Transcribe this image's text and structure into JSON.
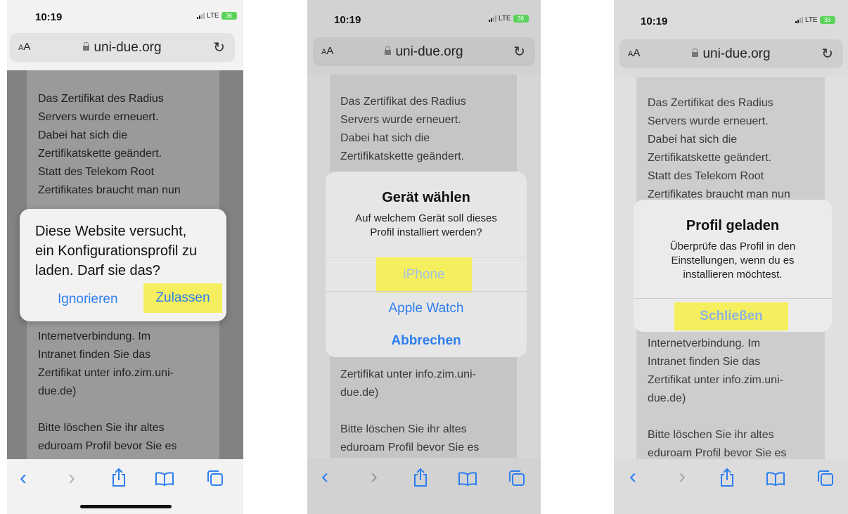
{
  "common": {
    "time": "10:19",
    "network": "LTE",
    "battery": "36",
    "text_size_button": "AA",
    "domain": "uni-due.org",
    "reload_icon": "reload-icon",
    "toolbar_icons": [
      "back-chevron-icon",
      "forward-chevron-icon",
      "share-icon",
      "bookmarks-icon",
      "tabs-icon"
    ]
  },
  "panels": [
    {
      "page_text_top": [
        "Das Zertifikat des Radius",
        "Servers wurde erneuert.",
        "Dabei hat sich die",
        "Zertifikatskette geändert.",
        "Statt des Telekom Root",
        "Zertifikates braucht man nun"
      ],
      "page_text_bottom": [
        "Internetverbindung. Im",
        "Intranet finden Sie das",
        "Zertifikat unter info.zim.uni-",
        "due.de)"
      ],
      "page_text_end": [
        "Bitte löschen Sie ihr altes",
        "eduroam Profil bevor Sie es"
      ],
      "dialog": {
        "message": [
          "Diese Website versucht,",
          "ein Konfigurationsprofil zu",
          "laden. Darf sie das?"
        ],
        "buttons": [
          "Ignorieren",
          "Zulassen"
        ],
        "highlighted_button": "Zulassen"
      }
    },
    {
      "page_text_top": [
        "Das Zertifikat des Radius",
        "Servers wurde erneuert.",
        "Dabei hat sich die",
        "Zertifikatskette geändert."
      ],
      "page_text_bottom": [
        "Zertifikat unter info.zim.uni-",
        "due.de)"
      ],
      "page_text_end": [
        "Bitte löschen Sie ihr altes",
        "eduroam Profil bevor Sie es"
      ],
      "dialog": {
        "title": "Gerät wählen",
        "message": [
          "Auf welchem Gerät soll dieses",
          "Profil installiert werden?"
        ],
        "buttons": [
          "iPhone",
          "Apple Watch",
          "Abbrechen"
        ],
        "highlighted_button": "iPhone"
      }
    },
    {
      "page_text_top": [
        "Das Zertifikat des Radius",
        "Servers wurde erneuert.",
        "Dabei hat sich die",
        "Zertifikatskette geändert.",
        "Statt des Telekom Root",
        "Zertifikates braucht man nun"
      ],
      "page_text_bottom": [
        "Internetverbindung. Im",
        "Intranet finden Sie das",
        "Zertifikat unter info.zim.uni-",
        "due.de)"
      ],
      "page_text_end": [
        "Bitte löschen Sie ihr altes",
        "eduroam Profil bevor Sie es"
      ],
      "dialog": {
        "title": "Profil geladen",
        "message": [
          "Überprüfe das Profil in den",
          "Einstellungen, wenn du es",
          "installieren möchtest."
        ],
        "buttons": [
          "Schließen"
        ],
        "highlighted_button": "Schließen"
      }
    }
  ]
}
